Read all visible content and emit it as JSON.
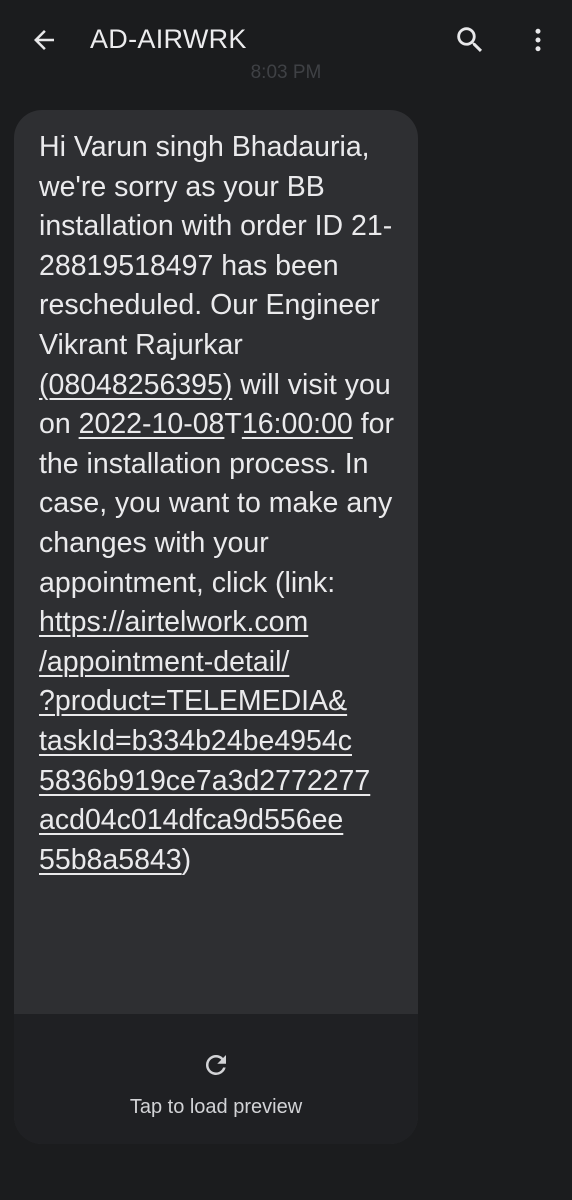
{
  "app_bar": {
    "title": "AD-AIRWRK",
    "back_icon": "arrow-back-icon",
    "search_icon": "search-icon",
    "more_icon": "more-vert-icon"
  },
  "message": {
    "timestamp": "8:03 PM",
    "text_before_phone": "Hi Varun singh Bhadauria, we're sorry as your BB installation with order ID 21-28819518497 has been rescheduled. Our Engineer Vikrant Rajurkar ",
    "phone_link": "(08048256395)",
    "text_after_phone": " will visit you on ",
    "date_link": "2022-10-08",
    "date_separator": "T",
    "time_link": "16:00:00",
    "text_before_url": " for the installation process. In case, you want to make any changes with your appointment, click (link: ",
    "url_link": "https://airtelwork.com/appointment-detail/?product=TELEMEDIA&taskId=b334b24be4954c5836b919ce7a3d2772277acd04c014dfca9d556ee55b8a5843",
    "text_after_url": ")"
  },
  "preview": {
    "label": "Tap to load preview",
    "icon": "refresh-icon"
  },
  "colors": {
    "background": "#1b1c1e",
    "bubble": "#2e2f32",
    "preview_panel": "#1f2023",
    "text": "#eaeaec",
    "timestamp": "#3f4145"
  }
}
